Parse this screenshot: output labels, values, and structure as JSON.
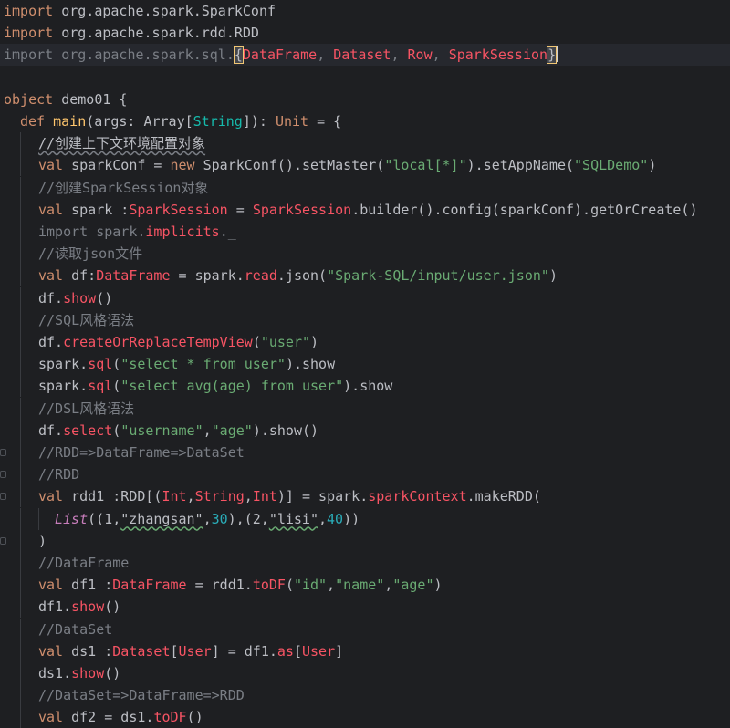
{
  "lines": [
    {
      "id": "l1",
      "segs": [
        [
          "kw",
          "import"
        ],
        [
          "p",
          " org.apache.spark.SparkConf"
        ]
      ]
    },
    {
      "id": "l2",
      "segs": [
        [
          "kw",
          "import"
        ],
        [
          "p",
          " org.apache.spark.rdd.RDD"
        ]
      ]
    },
    {
      "id": "l3",
      "segs": [
        [
          "dim",
          "import org.apache.spark.sql."
        ],
        [
          "brace",
          "{"
        ],
        [
          "red",
          "DataFrame"
        ],
        [
          "dim",
          ", "
        ],
        [
          "red",
          "Dataset"
        ],
        [
          "dim",
          ", "
        ],
        [
          "red",
          "Row"
        ],
        [
          "dim",
          ", "
        ],
        [
          "red",
          "SparkSession"
        ],
        [
          "brace",
          "}"
        ]
      ]
    },
    {
      "id": "l4",
      "segs": []
    },
    {
      "id": "l5",
      "segs": [
        [
          "kw",
          "object"
        ],
        [
          "p",
          " demo01 {"
        ]
      ]
    },
    {
      "id": "l6",
      "segs": [
        [
          "kw",
          "def"
        ],
        [
          "p",
          " "
        ],
        [
          "yel",
          "main"
        ],
        [
          "p",
          "(args: Array["
        ],
        [
          "tp",
          "String"
        ],
        [
          "p",
          "]): "
        ],
        [
          "unit",
          "Unit"
        ],
        [
          "p",
          " = {"
        ]
      ]
    },
    {
      "id": "l7",
      "segs": [
        [
          "wavyc",
          "//创建上下文环境配置对象"
        ]
      ]
    },
    {
      "id": "l8",
      "segs": [
        [
          "kw",
          "val"
        ],
        [
          "p",
          " sparkConf = "
        ],
        [
          "kw",
          "new"
        ],
        [
          "p",
          " SparkConf().setMaster("
        ],
        [
          "str",
          "\"local[*]\""
        ],
        [
          "p",
          ").setAppName("
        ],
        [
          "str",
          "\"SQLDemo\""
        ],
        [
          "p",
          ")"
        ]
      ]
    },
    {
      "id": "l9",
      "segs": [
        [
          "cm",
          "//创建SparkSession对象"
        ]
      ]
    },
    {
      "id": "l10",
      "segs": [
        [
          "kw",
          "val"
        ],
        [
          "p",
          " spark :"
        ],
        [
          "red",
          "SparkSession"
        ],
        [
          "p",
          " = "
        ],
        [
          "red",
          "SparkSession"
        ],
        [
          "p",
          ".builder().config(sparkConf).getOrCreate()"
        ]
      ]
    },
    {
      "id": "l11",
      "segs": [
        [
          "dim",
          "import spark."
        ],
        [
          "red",
          "implicits"
        ],
        [
          "dim",
          "._"
        ]
      ]
    },
    {
      "id": "l12",
      "segs": [
        [
          "cm",
          "//读取json文件"
        ]
      ]
    },
    {
      "id": "l13",
      "segs": [
        [
          "kw",
          "val"
        ],
        [
          "p",
          " df:"
        ],
        [
          "red",
          "DataFrame"
        ],
        [
          "p",
          " = spark."
        ],
        [
          "red",
          "read"
        ],
        [
          "p",
          ".json("
        ],
        [
          "str",
          "\"Spark-SQL/input/user.json\""
        ],
        [
          "p",
          ")"
        ]
      ]
    },
    {
      "id": "l14",
      "segs": [
        [
          "p",
          "df."
        ],
        [
          "red",
          "show"
        ],
        [
          "p",
          "()"
        ]
      ]
    },
    {
      "id": "l15",
      "segs": [
        [
          "cm",
          "//SQL风格语法"
        ]
      ]
    },
    {
      "id": "l16",
      "segs": [
        [
          "p",
          "df."
        ],
        [
          "red",
          "createOrReplaceTempView"
        ],
        [
          "p",
          "("
        ],
        [
          "str",
          "\"user\""
        ],
        [
          "p",
          ")"
        ]
      ]
    },
    {
      "id": "l17",
      "segs": [
        [
          "p",
          "spark."
        ],
        [
          "red",
          "sql"
        ],
        [
          "p",
          "("
        ],
        [
          "str",
          "\"select * from user\""
        ],
        [
          "p",
          ").show"
        ]
      ]
    },
    {
      "id": "l18",
      "segs": [
        [
          "p",
          "spark."
        ],
        [
          "red",
          "sql"
        ],
        [
          "p",
          "("
        ],
        [
          "str",
          "\"select avg(age) from user\""
        ],
        [
          "p",
          ").show"
        ]
      ]
    },
    {
      "id": "l19",
      "segs": [
        [
          "cm",
          "//DSL风格语法"
        ]
      ]
    },
    {
      "id": "l20",
      "segs": [
        [
          "p",
          "df."
        ],
        [
          "red",
          "select"
        ],
        [
          "p",
          "("
        ],
        [
          "str",
          "\"username\""
        ],
        [
          "p",
          ","
        ],
        [
          "str",
          "\"age\""
        ],
        [
          "p",
          ").show()"
        ]
      ]
    },
    {
      "id": "l21",
      "segs": [
        [
          "cm",
          "//RDD=>DataFrame=>DataSet"
        ]
      ]
    },
    {
      "id": "l22",
      "segs": [
        [
          "cm",
          "//RDD"
        ]
      ]
    },
    {
      "id": "l23",
      "segs": [
        [
          "kw",
          "val"
        ],
        [
          "p",
          " rdd1 :RDD[("
        ],
        [
          "red",
          "Int"
        ],
        [
          "p",
          ","
        ],
        [
          "red",
          "String"
        ],
        [
          "p",
          ","
        ],
        [
          "red",
          "Int"
        ],
        [
          "p",
          ")] = spark."
        ],
        [
          "red",
          "sparkContext"
        ],
        [
          "p",
          ".makeRDD("
        ]
      ]
    },
    {
      "id": "l24",
      "segs": [
        [
          "cls",
          "List"
        ],
        [
          "p",
          "((1,"
        ],
        [
          "wavy",
          "\"zhangsan\""
        ],
        [
          "p",
          ","
        ],
        [
          "num",
          "30"
        ],
        [
          "p",
          "),(2,"
        ],
        [
          "wavy",
          "\"lisi\""
        ],
        [
          "p",
          ","
        ],
        [
          "num",
          "40"
        ],
        [
          "p",
          "))"
        ]
      ]
    },
    {
      "id": "l25",
      "segs": [
        [
          "p",
          ")"
        ]
      ]
    },
    {
      "id": "l26",
      "segs": [
        [
          "cm",
          "//DataFrame"
        ]
      ]
    },
    {
      "id": "l27",
      "segs": [
        [
          "kw",
          "val"
        ],
        [
          "p",
          " df1 :"
        ],
        [
          "red",
          "DataFrame"
        ],
        [
          "p",
          " = rdd1."
        ],
        [
          "red",
          "toDF"
        ],
        [
          "p",
          "("
        ],
        [
          "str",
          "\"id\""
        ],
        [
          "p",
          ","
        ],
        [
          "str",
          "\"name\""
        ],
        [
          "p",
          ","
        ],
        [
          "str",
          "\"age\""
        ],
        [
          "p",
          ")"
        ]
      ]
    },
    {
      "id": "l28",
      "segs": [
        [
          "p",
          "df1."
        ],
        [
          "red",
          "show"
        ],
        [
          "p",
          "()"
        ]
      ]
    },
    {
      "id": "l29",
      "segs": [
        [
          "cm",
          "//DataSet"
        ]
      ]
    },
    {
      "id": "l30",
      "segs": [
        [
          "kw",
          "val"
        ],
        [
          "p",
          " ds1 :"
        ],
        [
          "red",
          "Dataset"
        ],
        [
          "p",
          "["
        ],
        [
          "red",
          "User"
        ],
        [
          "p",
          "] = df1."
        ],
        [
          "red",
          "as"
        ],
        [
          "p",
          "["
        ],
        [
          "red",
          "User"
        ],
        [
          "p",
          "]"
        ]
      ]
    },
    {
      "id": "l31",
      "segs": [
        [
          "p",
          "ds1."
        ],
        [
          "red",
          "show"
        ],
        [
          "p",
          "()"
        ]
      ]
    },
    {
      "id": "l32",
      "segs": [
        [
          "cm",
          "//DataSet=>DataFrame=>RDD"
        ]
      ]
    },
    {
      "id": "l33",
      "segs": [
        [
          "kw",
          "val"
        ],
        [
          "p",
          " df2 = ds1."
        ],
        [
          "red",
          "toDF"
        ],
        [
          "p",
          "()"
        ]
      ]
    }
  ]
}
